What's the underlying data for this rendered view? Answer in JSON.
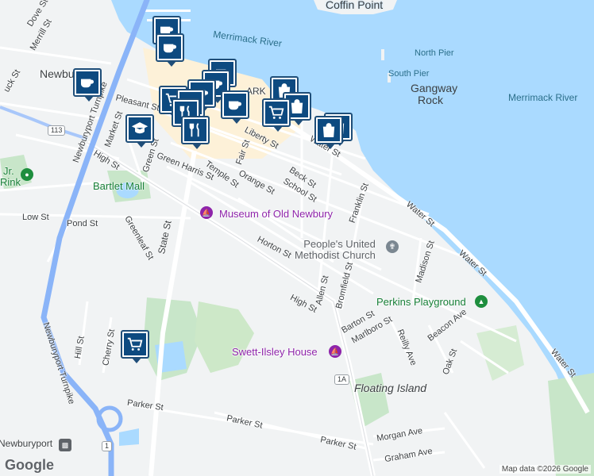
{
  "map": {
    "colors": {
      "water": "#aadaff",
      "land": "#f1f3f4",
      "park": "#c8e6c9",
      "road": "#ffffff",
      "highway": "#8ab4f8",
      "marker": "#0d4a80"
    },
    "water_labels": {
      "merrimack_1": "Merrimack River",
      "merrimack_2": "Merrimack River",
      "north_pier": "North Pier",
      "south_pier": "South Pier",
      "gangway_rock": "Gangway Rock",
      "coffin_point": "Coffin Point"
    },
    "places": {
      "newburyport_top": "Newbur",
      "newburyport_bottom": "Newburyport",
      "floating_island": "Floating Island"
    },
    "pois": {
      "museum": "Museum of Old Newbury",
      "church_line1": "People's United",
      "church_line2": "Methodist Church",
      "perkins": "Perkins Playground",
      "swett": "Swett-Ilsley House",
      "bartlet": "Bartlet Mall",
      "jr_rink_1": "Jr.",
      "jr_rink_2": "Rink",
      "market_partial": "ARK"
    },
    "streets": {
      "dove": "Dove St",
      "merrill": "Merrill St",
      "buck": "uck St",
      "pleasant": "Pleasant St",
      "market": "Market St",
      "turnpike_upper": "Newburyport Turnpike",
      "turnpike_lower": "Newburyport Turnpike",
      "high_upper": "High St",
      "high_lower": "High St",
      "green": "Green St",
      "green_harris": "Green Harris St",
      "temple": "Temple St",
      "orange": "Orange St",
      "fair": "Fair St",
      "liberty": "Liberty St",
      "water_1": "Water St",
      "water_2": "Water St",
      "water_3": "Water St",
      "water_4": "Water St",
      "beck": "Beck St",
      "school": "School St",
      "franklin": "Franklin St",
      "low": "Low St",
      "pond": "Pond St",
      "greenleaf": "Greenleaf St",
      "state": "State St",
      "horton": "Horton St",
      "allen": "Allen St",
      "bromfield": "Bromfield St",
      "madison": "Madison St",
      "barton": "Barton St",
      "marlboro": "Marlboro St",
      "reilly": "Reilly Ave",
      "beacon": "Beacon Ave",
      "oak": "Oak St",
      "hill": "Hill St",
      "cherry": "Cherry St",
      "parker_1": "Parker St",
      "parker_2": "Parker St",
      "parker_3": "Parker St",
      "morgan": "Morgan Ave",
      "graham": "Graham Ave"
    },
    "shields": {
      "route_113": "113",
      "route_1": "1",
      "route_1a": "1A"
    },
    "icons": [
      "coffee-icon",
      "shopping-cart-icon",
      "restaurant-icon",
      "shopping-bag-icon",
      "school-cap-icon"
    ],
    "logo": "Google",
    "attribution": "Map data ©2026 Google"
  }
}
